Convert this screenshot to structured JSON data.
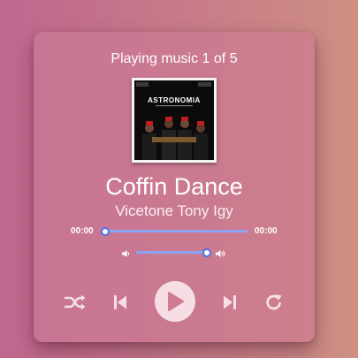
{
  "player": {
    "status_text": "Playing music 1 of 5",
    "track": {
      "title": "Coffin Dance",
      "artist": "Vicetone Tony Igy",
      "cover_text": "ASTRONOMIA"
    },
    "progress": {
      "current_time": "00:00",
      "total_time": "00:00",
      "fraction": 0
    },
    "volume": {
      "fraction": 1
    },
    "controls": [
      "shuffle-icon",
      "previous-icon",
      "play-icon",
      "next-icon",
      "repeat-icon"
    ]
  },
  "colors": {
    "background_left": "#c0668f",
    "background_right": "#cf8f84",
    "accent": "#4f6ff0",
    "track": "#8da4f6",
    "icon": "#f7dfe7"
  }
}
